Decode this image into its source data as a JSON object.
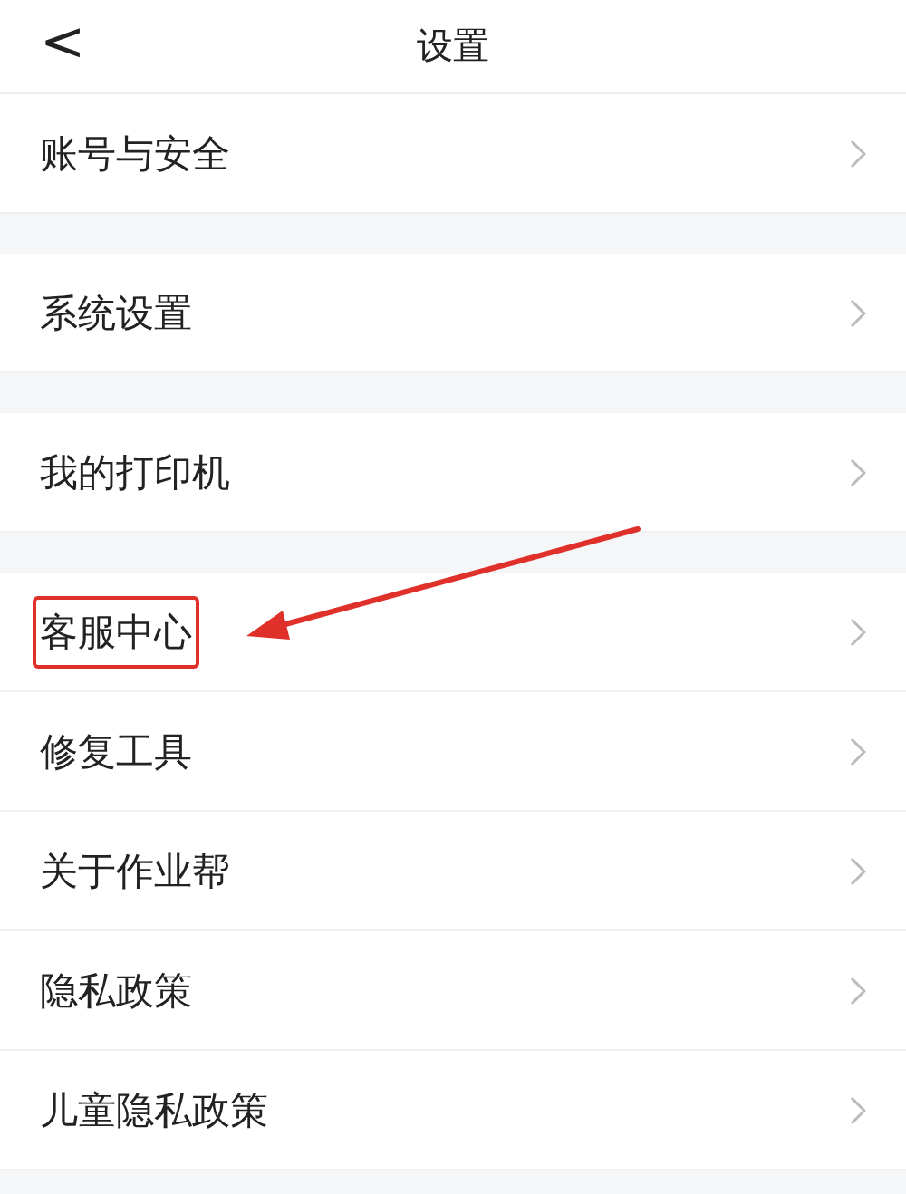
{
  "header": {
    "back": "<",
    "title": "设置"
  },
  "groups": [
    {
      "items": [
        {
          "label": "账号与安全",
          "highlighted": false
        }
      ]
    },
    {
      "items": [
        {
          "label": "系统设置",
          "highlighted": false
        }
      ]
    },
    {
      "items": [
        {
          "label": "我的打印机",
          "highlighted": false
        }
      ]
    },
    {
      "items": [
        {
          "label": "客服中心",
          "highlighted": true
        },
        {
          "label": "修复工具",
          "highlighted": false
        },
        {
          "label": "关于作业帮",
          "highlighted": false
        },
        {
          "label": "隐私政策",
          "highlighted": false
        },
        {
          "label": "儿童隐私政策",
          "highlighted": false
        }
      ]
    }
  ]
}
